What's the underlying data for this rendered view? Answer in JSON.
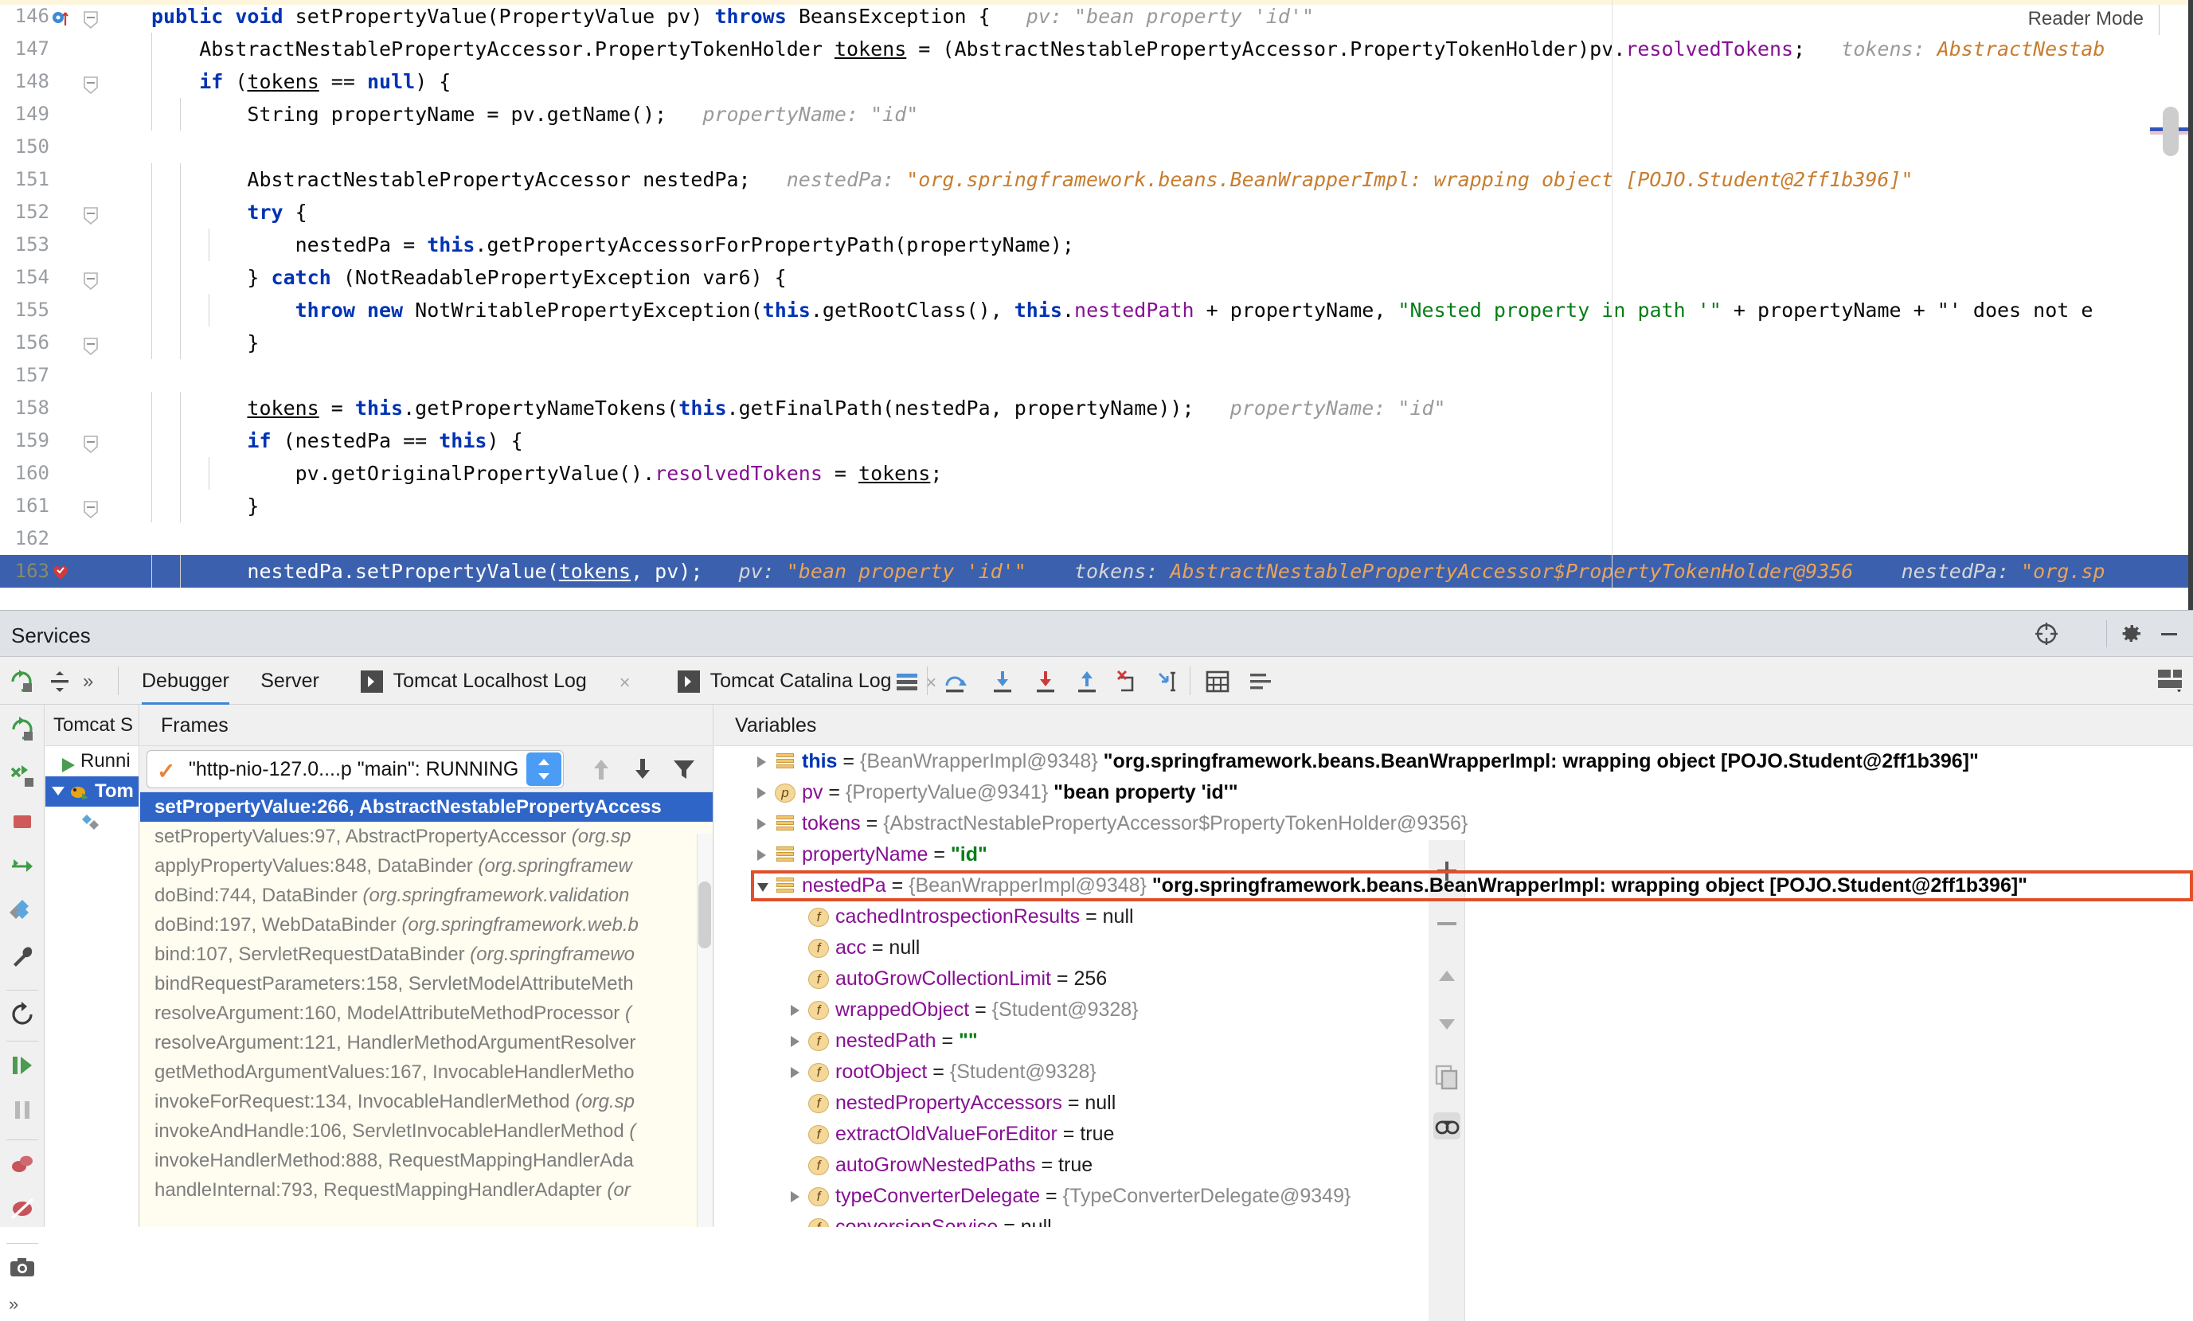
{
  "editor": {
    "reader_mode_label": "Reader Mode",
    "lines": [
      {
        "num": "146",
        "indent": 0,
        "gutter": "breakpoint-arrow",
        "fold": true,
        "code": "public void setPropertyValue(PropertyValue pv) throws BeansException {",
        "hint_name": "pv:",
        "hint_val": "\"bean property 'id'\"",
        "hint_gray": true
      },
      {
        "num": "147",
        "indent": 1,
        "gutter": "",
        "fold": false,
        "code": "AbstractNestablePropertyAccessor.PropertyTokenHolder tokens = (AbstractNestablePropertyAccessor.PropertyTokenHolder)pv.resolvedTokens;",
        "hint_name": "tokens:",
        "hint_val": "AbstractNestab",
        "hint_gray": false
      },
      {
        "num": "148",
        "indent": 1,
        "gutter": "",
        "fold": true,
        "code": "if (tokens == null) {",
        "hint_name": "",
        "hint_val": ""
      },
      {
        "num": "149",
        "indent": 2,
        "gutter": "",
        "fold": false,
        "code": "String propertyName = pv.getName();",
        "hint_name": "propertyName:",
        "hint_val": "\"id\"",
        "hint_gray": true
      },
      {
        "num": "150",
        "indent": 0,
        "gutter": "",
        "fold": false,
        "code": "",
        "hint_name": "",
        "hint_val": ""
      },
      {
        "num": "151",
        "indent": 2,
        "gutter": "",
        "fold": false,
        "code": "AbstractNestablePropertyAccessor nestedPa;",
        "hint_name": "nestedPa:",
        "hint_val": "\"org.springframework.beans.BeanWrapperImpl: wrapping object [POJO.Student@2ff1b396]\"",
        "hint_gray": false
      },
      {
        "num": "152",
        "indent": 2,
        "gutter": "",
        "fold": true,
        "code": "try {",
        "hint_name": "",
        "hint_val": ""
      },
      {
        "num": "153",
        "indent": 3,
        "gutter": "",
        "fold": false,
        "code": "nestedPa = this.getPropertyAccessorForPropertyPath(propertyName);",
        "hint_name": "",
        "hint_val": ""
      },
      {
        "num": "154",
        "indent": 2,
        "gutter": "",
        "fold": true,
        "code": "} catch (NotReadablePropertyException var6) {",
        "hint_name": "",
        "hint_val": ""
      },
      {
        "num": "155",
        "indent": 3,
        "gutter": "",
        "fold": false,
        "code": "throw new NotWritablePropertyException(this.getRootClass(), this.nestedPath + propertyName, \"Nested property in path '\" + propertyName + \"' does not e",
        "hint_name": "",
        "hint_val": ""
      },
      {
        "num": "156",
        "indent": 2,
        "gutter": "",
        "fold": true,
        "code": "}",
        "hint_name": "",
        "hint_val": ""
      },
      {
        "num": "157",
        "indent": 0,
        "gutter": "",
        "fold": false,
        "code": "",
        "hint_name": "",
        "hint_val": ""
      },
      {
        "num": "158",
        "indent": 2,
        "gutter": "",
        "fold": false,
        "code": "tokens = this.getPropertyNameTokens(this.getFinalPath(nestedPa, propertyName));",
        "hint_name": "propertyName:",
        "hint_val": "\"id\"",
        "hint_gray": true
      },
      {
        "num": "159",
        "indent": 2,
        "gutter": "",
        "fold": true,
        "code": "if (nestedPa == this) {",
        "hint_name": "",
        "hint_val": ""
      },
      {
        "num": "160",
        "indent": 3,
        "gutter": "",
        "fold": false,
        "code": "pv.getOriginalPropertyValue().resolvedTokens = tokens;",
        "hint_name": "",
        "hint_val": ""
      },
      {
        "num": "161",
        "indent": 2,
        "gutter": "",
        "fold": true,
        "code": "}",
        "hint_name": "",
        "hint_val": ""
      },
      {
        "num": "162",
        "indent": 0,
        "gutter": "",
        "fold": false,
        "code": "",
        "hint_name": "",
        "hint_val": ""
      },
      {
        "num": "163",
        "indent": 2,
        "gutter": "execution-point",
        "fold": false,
        "current": true,
        "code": "nestedPa.setPropertyValue(tokens, pv);",
        "hint_name": "pv:",
        "hint_val": "\"bean property 'id'\"",
        "hint_name2": "tokens:",
        "hint_val2": "AbstractNestablePropertyAccessor$PropertyTokenHolder@9356",
        "hint_name3": "nestedPa:",
        "hint_val3": "\"org.sp"
      }
    ]
  },
  "services": {
    "title": "Services",
    "header_icons": [
      "target-icon",
      "gear-icon",
      "minimize-icon"
    ],
    "tabs": [
      {
        "label": "Debugger",
        "active": true,
        "icon": "",
        "closable": false
      },
      {
        "label": "Server",
        "active": false,
        "icon": "",
        "closable": false
      },
      {
        "label": "Tomcat Localhost Log",
        "active": false,
        "icon": "console-icon",
        "closable": true
      },
      {
        "label": "Tomcat Catalina Log",
        "active": false,
        "icon": "console-icon",
        "closable": true
      }
    ],
    "toolbar_icons": [
      "layout-icon",
      "step-over-icon",
      "step-into-icon",
      "force-step-into-icon",
      "step-out-icon",
      "drop-frame-icon",
      "run-to-cursor-icon",
      "evaluate-icon",
      "settings-rows-icon"
    ],
    "close_label": "×",
    "tool_strip_icons": [
      "rerun-icon",
      "rerun-failed-icon",
      "stop-icon",
      "redeploy-icon",
      "deploy-icon",
      "wrench-icon",
      "restart-icon",
      "resume-icon",
      "pause-icon",
      "mute-breakpoints-icon",
      "view-breakpoints-icon",
      "camera-icon",
      "more-icon"
    ],
    "server_tree": {
      "root_label": "Tomcat S",
      "items": [
        {
          "label": "Runni",
          "icon": "run-icon",
          "selected": false,
          "expander": ""
        },
        {
          "label": "Tom",
          "icon": "tomcat-icon",
          "selected": true,
          "expander": "down"
        },
        {
          "label": "",
          "icon": "deploy-icon",
          "selected": false,
          "expander": ""
        }
      ]
    },
    "frames": {
      "header": "Frames",
      "thread_value": "\"http-nio-127.0....p \"main\": RUNNING",
      "toolbar_icons": [
        "arrow-up-icon",
        "arrow-down-icon",
        "filter-icon"
      ],
      "items": [
        {
          "method": "setPropertyValue:266, AbstractNestablePropertyAccess",
          "pkg": "",
          "selected": true
        },
        {
          "method": "setPropertyValues:97, AbstractPropertyAccessor ",
          "pkg": "(org.sp",
          "selected": false
        },
        {
          "method": "applyPropertyValues:848, DataBinder ",
          "pkg": "(org.springframew",
          "selected": false
        },
        {
          "method": "doBind:744, DataBinder ",
          "pkg": "(org.springframework.validation",
          "selected": false
        },
        {
          "method": "doBind:197, WebDataBinder ",
          "pkg": "(org.springframework.web.b",
          "selected": false
        },
        {
          "method": "bind:107, ServletRequestDataBinder ",
          "pkg": "(org.springframewo",
          "selected": false
        },
        {
          "method": "bindRequestParameters:158, ServletModelAttributeMeth",
          "pkg": "",
          "selected": false
        },
        {
          "method": "resolveArgument:160, ModelAttributeMethodProcessor ",
          "pkg": "(",
          "selected": false
        },
        {
          "method": "resolveArgument:121, HandlerMethodArgumentResolver",
          "pkg": "",
          "selected": false
        },
        {
          "method": "getMethodArgumentValues:167, InvocableHandlerMetho",
          "pkg": "",
          "selected": false
        },
        {
          "method": "invokeForRequest:134, InvocableHandlerMethod ",
          "pkg": "(org.sp",
          "selected": false
        },
        {
          "method": "invokeAndHandle:106, ServletInvocableHandlerMethod ",
          "pkg": "(",
          "selected": false
        },
        {
          "method": "invokeHandlerMethod:888, RequestMappingHandlerAda",
          "pkg": "",
          "selected": false
        },
        {
          "method": "handleInternal:793, RequestMappingHandlerAdapter ",
          "pkg": "(or",
          "selected": false
        }
      ]
    },
    "variables": {
      "header": "Variables",
      "toolbar_icons": [
        "plus-icon",
        "minus-icon",
        "up-icon",
        "down-icon",
        "copy-icon",
        "watches-icon"
      ],
      "items": [
        {
          "indent": 0,
          "arrow": "right",
          "icon": "stack-icon",
          "name": "this",
          "name_style": "blue",
          "value_type": "{BeanWrapperImpl@9348}",
          "value_str": "\"org.springframework.beans.BeanWrapperImpl: wrapping object [POJO.Student@2ff1b396]\"",
          "highlight": false
        },
        {
          "indent": 0,
          "arrow": "right",
          "icon": "param-icon",
          "name": "pv",
          "name_style": "",
          "value_type": "{PropertyValue@9341}",
          "value_str": "\"bean property 'id'\"",
          "highlight": false
        },
        {
          "indent": 0,
          "arrow": "right",
          "icon": "stack-icon",
          "name": "tokens",
          "name_style": "",
          "value_type": "{AbstractNestablePropertyAccessor$PropertyTokenHolder@9356}",
          "value_str": "",
          "highlight": false
        },
        {
          "indent": 0,
          "arrow": "right",
          "icon": "stack-icon",
          "name": "propertyName",
          "name_style": "",
          "value_type": "",
          "value_green": "\"id\"",
          "highlight": false
        },
        {
          "indent": 0,
          "arrow": "down",
          "icon": "stack-icon",
          "name": "nestedPa",
          "name_style": "",
          "value_type": "{BeanWrapperImpl@9348}",
          "value_str": "\"org.springframework.beans.BeanWrapperImpl: wrapping object [POJO.Student@2ff1b396]\"",
          "highlight": true
        },
        {
          "indent": 1,
          "arrow": "",
          "icon": "field-icon",
          "name": "cachedIntrospectionResults",
          "value_plain": "null",
          "highlight": false
        },
        {
          "indent": 1,
          "arrow": "",
          "icon": "field-icon",
          "name": "acc",
          "value_plain": "null",
          "highlight": false
        },
        {
          "indent": 1,
          "arrow": "",
          "icon": "field-icon",
          "name": "autoGrowCollectionLimit",
          "value_plain": "256",
          "highlight": false
        },
        {
          "indent": 1,
          "arrow": "right",
          "icon": "field-icon",
          "name": "wrappedObject",
          "value_type": "{Student@9328}",
          "highlight": false
        },
        {
          "indent": 1,
          "arrow": "right",
          "icon": "field-icon",
          "name": "nestedPath",
          "value_green": "\"\"",
          "highlight": false
        },
        {
          "indent": 1,
          "arrow": "right",
          "icon": "field-icon",
          "name": "rootObject",
          "value_type": "{Student@9328}",
          "highlight": false
        },
        {
          "indent": 1,
          "arrow": "",
          "icon": "field-icon",
          "name": "nestedPropertyAccessors",
          "value_plain": "null",
          "highlight": false
        },
        {
          "indent": 1,
          "arrow": "",
          "icon": "field-icon",
          "name": "extractOldValueForEditor",
          "value_plain": "true",
          "highlight": false
        },
        {
          "indent": 1,
          "arrow": "",
          "icon": "field-icon",
          "name": "autoGrowNestedPaths",
          "value_plain": "true",
          "highlight": false
        },
        {
          "indent": 1,
          "arrow": "right",
          "icon": "field-icon",
          "name": "typeConverterDelegate",
          "value_type": "{TypeConverterDelegate@9349}",
          "highlight": false
        },
        {
          "indent": 1,
          "arrow": "",
          "icon": "field-icon",
          "name": "conversionService",
          "value_plain": "null",
          "highlight": false
        }
      ]
    }
  },
  "colors": {
    "accent_blue": "#3b60ad",
    "selection_blue": "#2f65c7",
    "highlight_orange": "#e0502a",
    "frames_bg": "#fffdf0",
    "keyword": "#0033b3",
    "string": "#067d17",
    "field": "#871094",
    "hint_value": "#c77d2e"
  }
}
